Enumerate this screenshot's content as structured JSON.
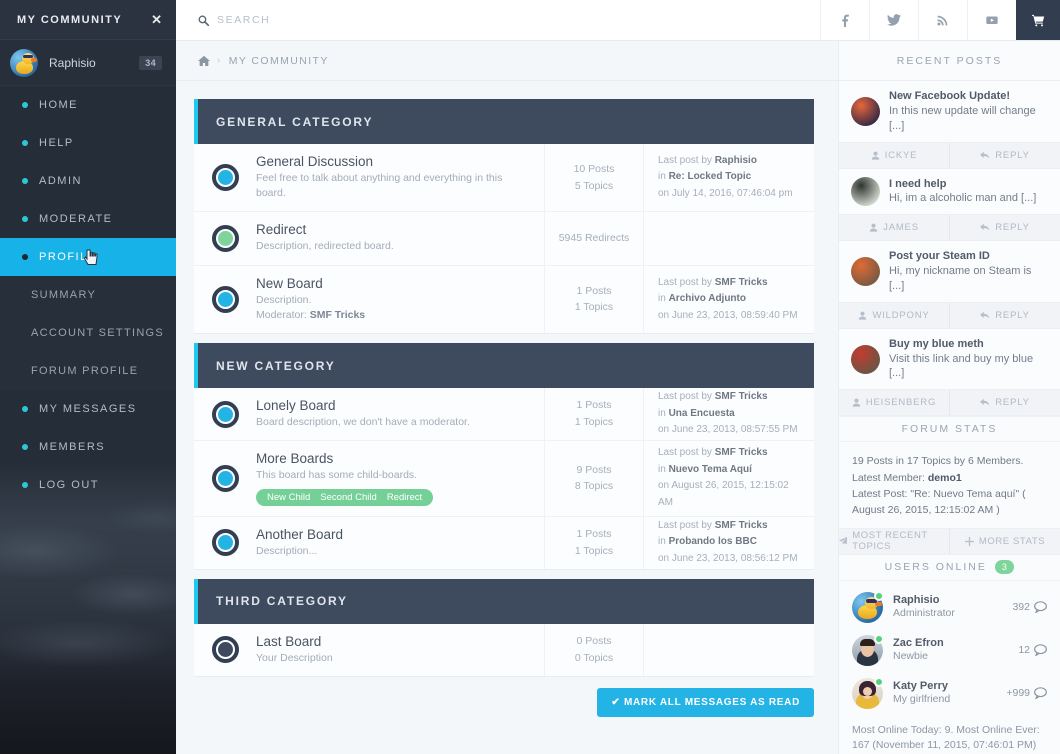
{
  "sidebar": {
    "title": "MY COMMUNITY",
    "close_icon": "close-icon",
    "user": {
      "name": "Raphisio",
      "badge": "34",
      "avatar": "duck-avatar"
    },
    "items": [
      {
        "label": "HOME",
        "type": "main",
        "active": false
      },
      {
        "label": "HELP",
        "type": "main",
        "active": false
      },
      {
        "label": "ADMIN",
        "type": "main",
        "active": false
      },
      {
        "label": "MODERATE",
        "type": "main",
        "active": false
      },
      {
        "label": "PROFILE",
        "type": "main",
        "active": true
      },
      {
        "label": "SUMMARY",
        "type": "sub",
        "active": false
      },
      {
        "label": "ACCOUNT SETTINGS",
        "type": "sub",
        "active": false
      },
      {
        "label": "FORUM PROFILE",
        "type": "sub",
        "active": false
      },
      {
        "label": "MY MESSAGES",
        "type": "main",
        "active": false
      },
      {
        "label": "MEMBERS",
        "type": "main",
        "active": false
      },
      {
        "label": "LOG OUT",
        "type": "main",
        "active": false
      }
    ]
  },
  "topbar": {
    "search_label": "SEARCH",
    "search_icon": "search-icon",
    "social": [
      {
        "name": "facebook-icon",
        "label": "f"
      },
      {
        "name": "twitter-icon",
        "label": "t"
      },
      {
        "name": "rss-icon",
        "label": "rss"
      },
      {
        "name": "youtube-icon",
        "label": "yt"
      },
      {
        "name": "cart-icon",
        "label": "cart"
      }
    ]
  },
  "breadcrumb": {
    "home_icon": "home-icon",
    "separator": "›",
    "current": "MY COMMUNITY"
  },
  "main": {
    "categories": [
      {
        "title": "GENERAL CATEGORY",
        "boards": [
          {
            "name": "General Discussion",
            "desc": "Feel free to talk about anything and everything in this board.",
            "moderator_label": "",
            "moderator": "",
            "children": [],
            "counts": [
              "10 Posts",
              "5 Topics"
            ],
            "icon_color": "#23b3e5",
            "last": {
              "prefix": "Last post by",
              "author": "Raphisio",
              "in_prefix": "in",
              "topic": "Re: Locked Topic",
              "date": "on July 14, 2016, 07:46:04 pm"
            }
          },
          {
            "name": "Redirect",
            "desc": "Description, redirected board.",
            "moderator_label": "",
            "moderator": "",
            "children": [],
            "counts": [
              "5945 Redirects"
            ],
            "icon_color": "#7ed49b",
            "last": null
          },
          {
            "name": "New Board",
            "desc": "Description.",
            "moderator_label": "Moderator:",
            "moderator": "SMF Tricks",
            "children": [],
            "counts": [
              "1 Posts",
              "1 Topics"
            ],
            "icon_color": "#23b3e5",
            "last": {
              "prefix": "Last post by",
              "author": "SMF Tricks",
              "in_prefix": "in",
              "topic": "Archivo Adjunto",
              "date": "on June 23, 2013, 08:59:40 PM"
            }
          }
        ]
      },
      {
        "title": "NEW CATEGORY",
        "boards": [
          {
            "name": "Lonely Board",
            "desc": "Board description, we don't have a moderator.",
            "moderator_label": "",
            "moderator": "",
            "children": [],
            "counts": [
              "1 Posts",
              "1 Topics"
            ],
            "icon_color": "#23b3e5",
            "last": {
              "prefix": "Last post by",
              "author": "SMF Tricks",
              "in_prefix": "in",
              "topic": "Una Encuesta",
              "date": "on June 23, 2013, 08:57:55 PM"
            }
          },
          {
            "name": "More Boards",
            "desc": "This board has some child-boards.",
            "moderator_label": "",
            "moderator": "",
            "children": [
              "New Child",
              "Second Child",
              "Redirect"
            ],
            "counts": [
              "9 Posts",
              "8 Topics"
            ],
            "icon_color": "#23b3e5",
            "last": {
              "prefix": "Last post by",
              "author": "SMF Tricks",
              "in_prefix": "in",
              "topic": "Nuevo Tema Aquí",
              "date": "on August 26, 2015, 12:15:02 AM"
            }
          },
          {
            "name": "Another Board",
            "desc": "Description...",
            "moderator_label": "",
            "moderator": "",
            "children": [],
            "counts": [
              "1 Posts",
              "1 Topics"
            ],
            "icon_color": "#23b3e5",
            "last": {
              "prefix": "Last post by",
              "author": "SMF Tricks",
              "in_prefix": "in",
              "topic": "Probando los BBC",
              "date": "on June 23, 2013, 08:56:12 PM"
            }
          }
        ]
      },
      {
        "title": "THIRD CATEGORY",
        "boards": [
          {
            "name": "Last Board",
            "desc": "Your Description",
            "moderator_label": "",
            "moderator": "",
            "children": [],
            "counts": [
              "0 Posts",
              "0 Topics"
            ],
            "icon_color": "#3e4a5e",
            "last": null
          }
        ]
      }
    ],
    "mark_read_button": "✔ MARK ALL MESSAGES AS READ"
  },
  "rside": {
    "recent_posts_title": "RECENT POSTS",
    "recent_posts": [
      {
        "title": "New Facebook Update!",
        "excerpt": "In this new update will change [...]",
        "author": "ICKYE",
        "reply": "REPLY",
        "av1": "#3a2a45",
        "av2": "#e8663a"
      },
      {
        "title": "I need help",
        "excerpt": "Hi, im a alcoholic man and [...]",
        "author": "JAMES",
        "reply": "REPLY",
        "av1": "#cfd4cb",
        "av2": "#2e3430"
      },
      {
        "title": "Post your Steam ID",
        "excerpt": "Hi, my nickname on Steam is [...]",
        "author": "WILDPONY",
        "reply": "REPLY",
        "av1": "#7a5a42",
        "av2": "#e06a35"
      },
      {
        "title": "Buy my blue meth",
        "excerpt": "Visit this link and buy my blue [...]",
        "author": "HEISENBERG",
        "reply": "REPLY",
        "av1": "#6b5544",
        "av2": "#c43b30"
      }
    ],
    "forum_stats_title": "FORUM STATS",
    "forum_stats_line1_pre": "19 Posts in 17 Topics by 6 Members. Latest Member: ",
    "forum_stats_member": "demo1",
    "forum_stats_line2": "Latest Post: \"Re: Nuevo Tema aquí\" ( August 26, 2015, 12:15:02 AM )",
    "stats_actions": [
      {
        "label": "MOST RECENT TOPICS",
        "icon": "paper-plane-icon"
      },
      {
        "label": "MORE STATS",
        "icon": "plus-icon"
      }
    ],
    "users_online_title": "USERS ONLINE",
    "users_online_count": "3",
    "users": [
      {
        "name": "Raphisio",
        "role": "Administrator",
        "count": "392",
        "av": "duck"
      },
      {
        "name": "Zac Efron",
        "role": "Newbie",
        "count": "12",
        "av": "zac"
      },
      {
        "name": "Katy Perry",
        "role": "My girlfriend",
        "count": "+999",
        "av": "katy"
      }
    ],
    "online_footer": "Most Online Today: 9. Most Online Ever: 167 (November 11, 2015, 07:46:01 PM)"
  }
}
